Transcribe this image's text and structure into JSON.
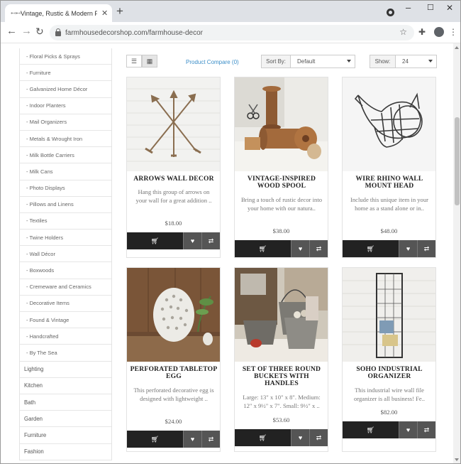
{
  "browser": {
    "tab_title": "Vintage, Rustic & Modern Farmhouse",
    "url": "farmhousedecorshop.com/farmhouse-decor",
    "icons": {
      "back": "arrow-left-icon",
      "forward": "arrow-right-icon",
      "reload": "reload-icon",
      "lock": "lock-icon",
      "star": "star-icon",
      "extensions": "puzzle-icon",
      "profile": "profile-icon",
      "menu": "kebab-menu-icon"
    }
  },
  "sidebar": {
    "sub_items": [
      "- Floral Picks & Sprays",
      "- Furniture",
      "- Galvanized Home Décor",
      "- Indoor Planters",
      "- Mail Organizers",
      "- Metals & Wrought Iron",
      "- Milk Bottle Carriers",
      "- Milk Cans",
      "- Photo Displays",
      "- Pillows and Linens",
      "- Textiles",
      "- Twine Holders",
      "- Wall Décor",
      "- Boxwoods",
      "- Cremeware and Ceramics",
      "- Decorative Items",
      "- Found & Vintage",
      "- Handcrafted",
      "- By The Sea"
    ],
    "top_items": [
      "Lighting",
      "Kitchen",
      "Bath",
      "Garden",
      "Furniture",
      "Fashion"
    ]
  },
  "controls": {
    "product_compare": "Product Compare (0)",
    "sort_label": "Sort By:",
    "sort_value": "Default",
    "show_label": "Show:",
    "show_value": "24"
  },
  "products": [
    {
      "name": "Arrows Wall Decor",
      "desc": "Hang this group of arrows on your wall for a great addition ..",
      "price": "$18.00"
    },
    {
      "name": "Vintage-Inspired Wood Spool",
      "desc": "Bring a touch of rustic decor into your home with our natura..",
      "price": "$38.00"
    },
    {
      "name": "Wire Rhino Wall Mount Head",
      "desc": "Include this unique item in your home as a stand alone or in..",
      "price": "$48.00"
    },
    {
      "name": "Perforated Tabletop Egg",
      "desc": "This perforated decorative egg is designed with lightweight ..",
      "price": "$24.00"
    },
    {
      "name": "Set of Three Round Buckets with Handles",
      "desc": "Large: 13\" x 10\" x 8\". Medium: 12\" x 9½\" x 7\". Small: 9½\" x ..",
      "price": "$53.60"
    },
    {
      "name": "Soho Industrial Organizer",
      "desc": "This industrial wire wall file organizer is all business! Fe..",
      "price": "$82.00"
    }
  ]
}
